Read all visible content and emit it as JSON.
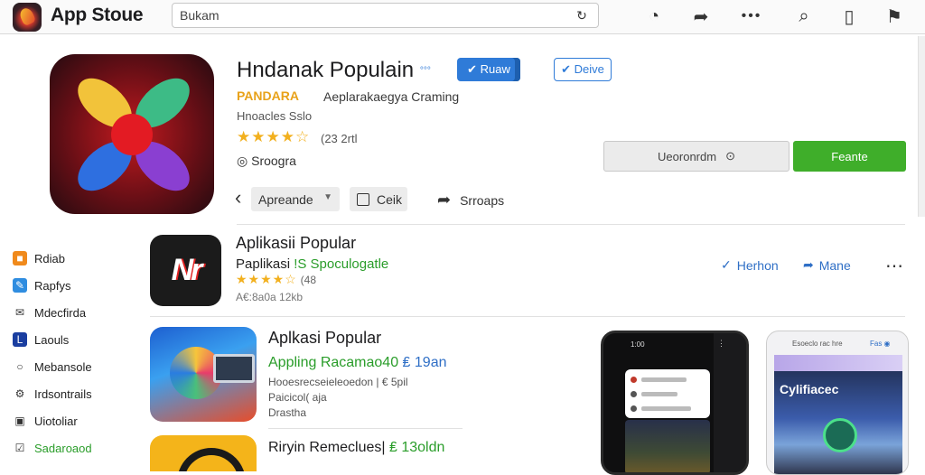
{
  "topbar": {
    "app_name": "App Stoue",
    "search_value": "Bukam",
    "search_icon": "refresh-icon",
    "icons": [
      "account-icon",
      "share-icon",
      "more-icon",
      "search-icon",
      "library-icon",
      "bookmark-icon"
    ],
    "icon_glyphs": [
      "◎",
      "⇱",
      "•••",
      "⌕",
      "▯▯",
      "✦"
    ]
  },
  "hero": {
    "title": "Hndanak Populain",
    "title_tag": "°°°",
    "badge_primary": "✔ Ruaw",
    "badge_secondary": "✔ Deive",
    "developer_logo": "PANDARA",
    "developer": "Aeplarakaegya Craming",
    "meta": "Hnoacles Sslo",
    "rating_stars": "★★★★☆",
    "rating_count": "(23 2rtl",
    "category": "Sroogra",
    "button_secondary": "Ueoronrdm",
    "button_primary": "Feante",
    "dropdown_label": "Apreande",
    "checkbox_label": "Ceik",
    "share_label": "Srroaps"
  },
  "sidebar": {
    "items": [
      {
        "label": "Rdiab",
        "color": "#f08a1c",
        "glyph": "■",
        "icon": "orange-square-icon"
      },
      {
        "label": "Rapfys",
        "color": "#2f8de0",
        "glyph": "✎",
        "icon": "edit-icon"
      },
      {
        "label": "Mdecfirda",
        "color": "#ffffff",
        "glyph": "✉",
        "icon": "mail-icon"
      },
      {
        "label": "Laouls",
        "color": "#1a3ea0",
        "glyph": "L",
        "icon": "logo-icon"
      },
      {
        "label": "Mebansole",
        "color": "#ffffff",
        "glyph": "○",
        "icon": "chat-icon"
      },
      {
        "label": "Irdsontrails",
        "color": "#ffffff",
        "glyph": "⚙",
        "icon": "settings-icon"
      },
      {
        "label": "Uiotoliar",
        "color": "#ffffff",
        "glyph": "▣",
        "icon": "window-icon"
      },
      {
        "label": "Sadaroaod",
        "color": "#ffffff",
        "glyph": "☑",
        "icon": "checkbox-icon",
        "green": true
      }
    ]
  },
  "apps": [
    {
      "title": "Aplikasii Popular",
      "sub_prefix": "Paplikasi ",
      "sub_highlight": "!S Spoculogatle",
      "stars": "★★★★☆",
      "rating_num": "(48",
      "extra": "A€:8a0a 12kb",
      "link1": "Herhon",
      "link2": "Mane",
      "logo_text": "Nr"
    },
    {
      "title": "Aplkasi Popular",
      "sub_prefix": "Appling Racamao40 ",
      "sub_highlight": "₤ 19an",
      "line1": "Hooesrecseieleoedon | € 5pil",
      "line2": "Paicicol( aja",
      "line3": "Drastha"
    },
    {
      "title_prefix": "Riryin Remeclues| ",
      "title_highlight": "₤ 13oldn"
    }
  ],
  "screens": {
    "phone_header": "1:00",
    "tablet_header": "Esoeclo rac hre",
    "tablet_header_right": "Fas ◉",
    "tablet_title": "Cylifiacec"
  }
}
